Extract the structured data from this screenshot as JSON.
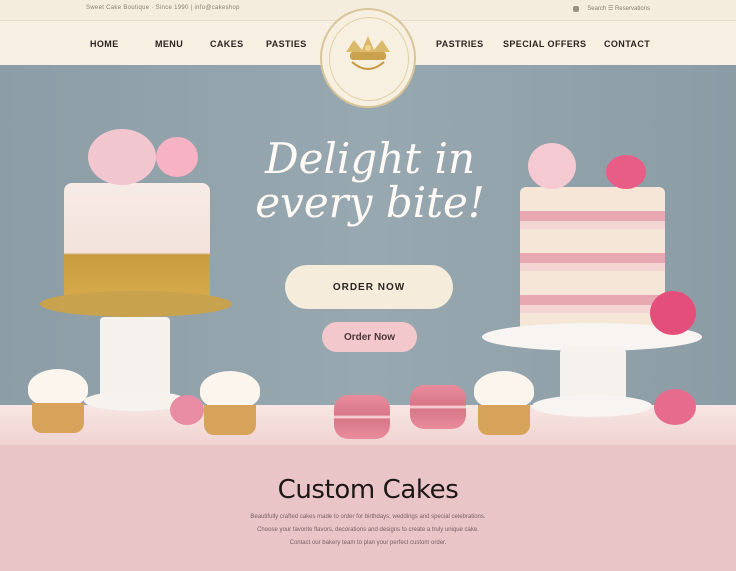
{
  "topbar": {
    "left_text": "Sweet Cake Boutique · Since 1990   |   info@cakeshop",
    "right_text": "Search   ☰   Reservations"
  },
  "nav": {
    "items": [
      "HOME",
      "MENU",
      "CAKES",
      "PASTIES",
      "PASTRIES",
      "SPECIAL OFFERS",
      "CONTACT"
    ]
  },
  "logo": {
    "alt": "bakery emblem"
  },
  "hero": {
    "headline_line1": "Delight in",
    "headline_line2": "every bite!",
    "primary_button": "ORDER NOW",
    "secondary_button": "Order Now"
  },
  "section": {
    "title": "Custom Cakes",
    "description_line1": "Beautifully crafted cakes made to order for birthdays, weddings and special celebrations.",
    "description_line2": "Choose your favorite flavors, decorations and designs to create a truly unique cake.",
    "description_line3": "Contact our bakery team to plan your perfect custom order."
  },
  "colors": {
    "accent_pink": "#e9c5c8",
    "button_cream": "#f6ecdc",
    "button_pink": "#f2c8cc",
    "hero_bg": "#8e9ea8",
    "gold": "#c9a24d"
  }
}
